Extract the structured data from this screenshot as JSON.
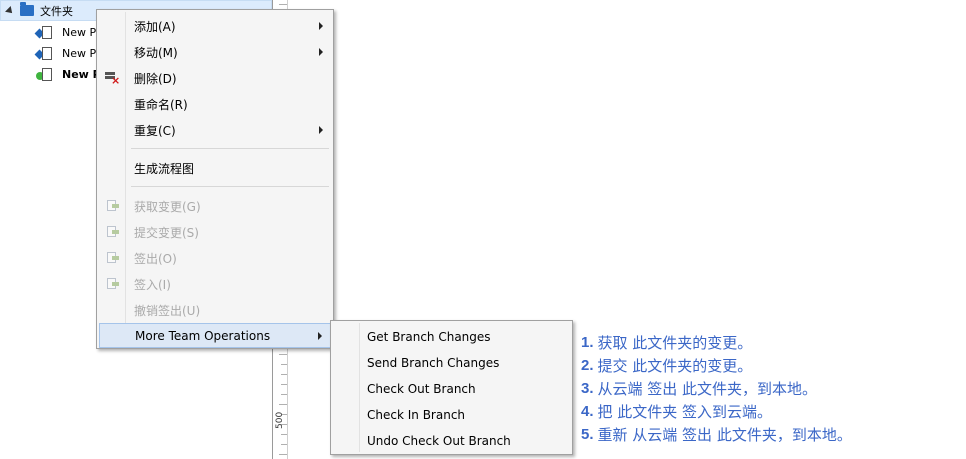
{
  "tree": {
    "root_label": "文件夹",
    "items": [
      {
        "label": "New P",
        "bold": false
      },
      {
        "label": "New P",
        "bold": false
      },
      {
        "label": "New P",
        "bold": true
      }
    ]
  },
  "ruler": {
    "label": "500"
  },
  "context_menu": {
    "add": "添加(A)",
    "move": "移动(M)",
    "delete": "删除(D)",
    "rename": "重命名(R)",
    "duplicate": "重复(C)",
    "generate_flowchart": "生成流程图",
    "get_changes": "获取变更(G)",
    "submit_changes": "提交变更(S)",
    "check_out": "签出(O)",
    "check_in": "签入(I)",
    "undo_check_out": "撤销签出(U)",
    "more_team": "More Team Operations"
  },
  "submenu": {
    "items": [
      "Get Branch Changes",
      "Send Branch Changes",
      "Check Out Branch",
      "Check In Branch",
      "Undo Check Out Branch"
    ]
  },
  "notes": [
    {
      "num": "1.",
      "text": "获取 此文件夹的变更。"
    },
    {
      "num": "2.",
      "text": "提交 此文件夹的变更。"
    },
    {
      "num": "3.",
      "text": "从云端 签出 此文件夹，到本地。"
    },
    {
      "num": "4.",
      "text": "把 此文件夹 签入到云端。"
    },
    {
      "num": "5.",
      "text": "重新 从云端 签出 此文件夹，到本地。"
    }
  ],
  "colors": {
    "note_text": "#3b67c7",
    "selection": "#dcebfc",
    "menu_bg": "#f5f5f5"
  }
}
